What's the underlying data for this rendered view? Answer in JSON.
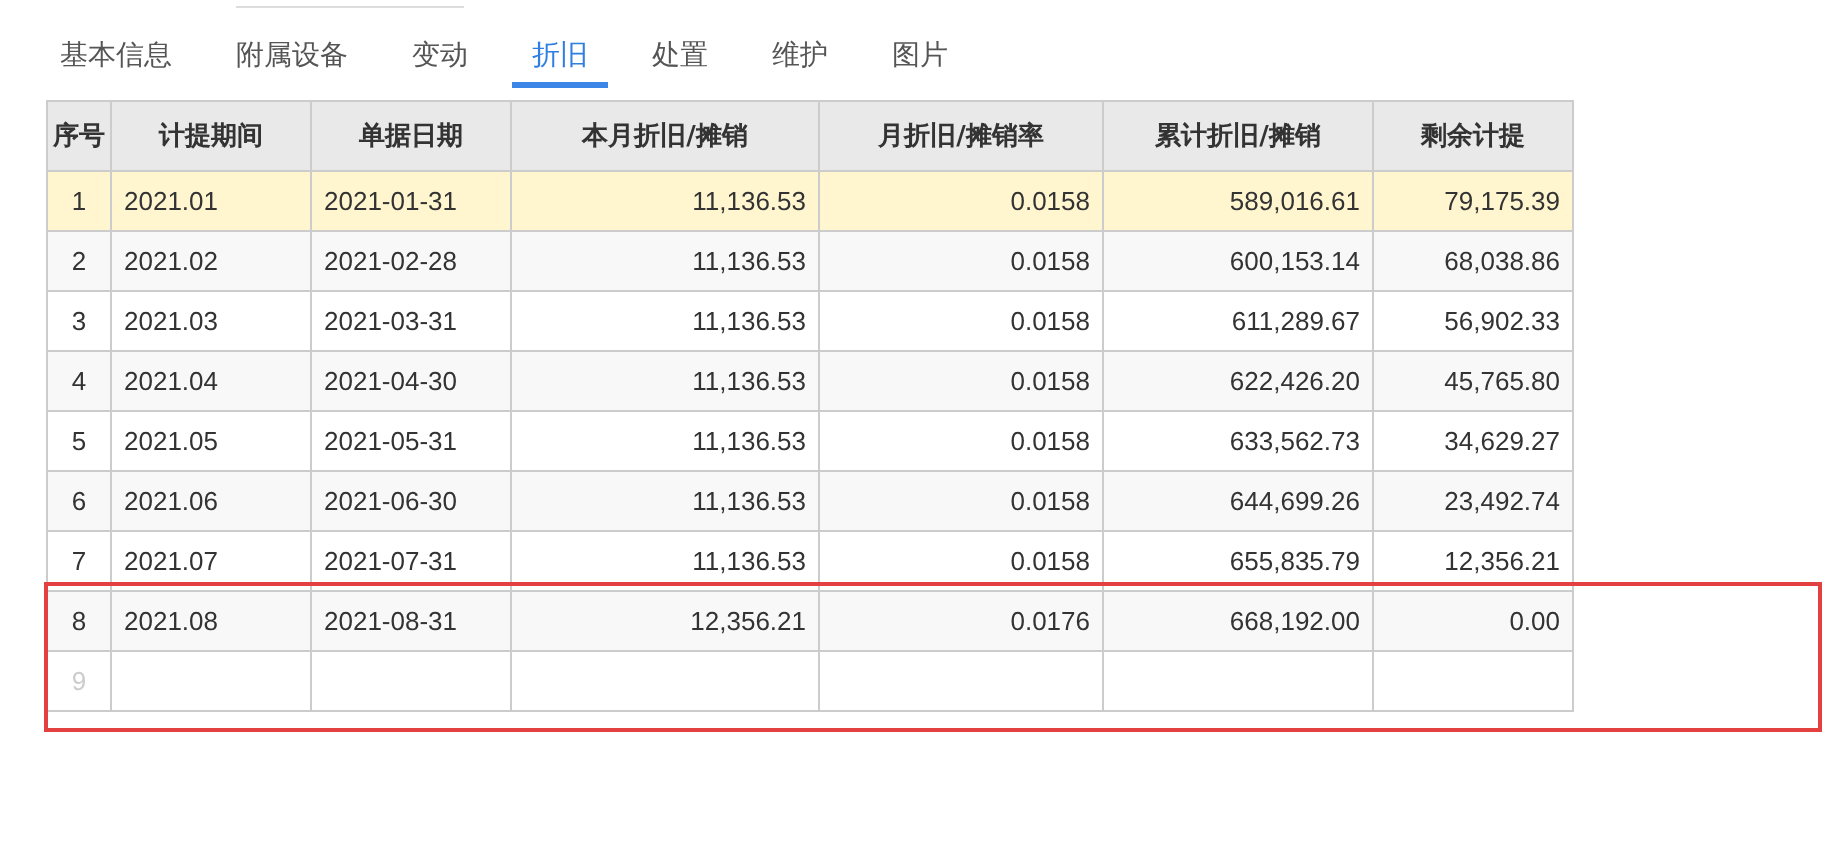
{
  "tabs": [
    {
      "label": "基本信息",
      "selected": false
    },
    {
      "label": "附属设备",
      "selected": false
    },
    {
      "label": "变动",
      "selected": false
    },
    {
      "label": "折旧",
      "selected": true
    },
    {
      "label": "处置",
      "selected": false
    },
    {
      "label": "维护",
      "selected": false
    },
    {
      "label": "图片",
      "selected": false
    }
  ],
  "table": {
    "columns": [
      "序号",
      "计提期间",
      "单据日期",
      "本月折旧/摊销",
      "月折旧/摊销率",
      "累计折旧/摊销",
      "剩余计提"
    ],
    "rows": [
      {
        "cells": [
          "1",
          "2021.01",
          "2021-01-31",
          "11,136.53",
          "0.0158",
          "589,016.61",
          "79,175.39"
        ],
        "selected": true,
        "boxed": false
      },
      {
        "cells": [
          "2",
          "2021.02",
          "2021-02-28",
          "11,136.53",
          "0.0158",
          "600,153.14",
          "68,038.86"
        ],
        "selected": false,
        "boxed": false
      },
      {
        "cells": [
          "3",
          "2021.03",
          "2021-03-31",
          "11,136.53",
          "0.0158",
          "611,289.67",
          "56,902.33"
        ],
        "selected": false,
        "boxed": false
      },
      {
        "cells": [
          "4",
          "2021.04",
          "2021-04-30",
          "11,136.53",
          "0.0158",
          "622,426.20",
          "45,765.80"
        ],
        "selected": false,
        "boxed": false
      },
      {
        "cells": [
          "5",
          "2021.05",
          "2021-05-31",
          "11,136.53",
          "0.0158",
          "633,562.73",
          "34,629.27"
        ],
        "selected": false,
        "boxed": false
      },
      {
        "cells": [
          "6",
          "2021.06",
          "2021-06-30",
          "11,136.53",
          "0.0158",
          "644,699.26",
          "23,492.74"
        ],
        "selected": false,
        "boxed": false
      },
      {
        "cells": [
          "7",
          "2021.07",
          "2021-07-31",
          "11,136.53",
          "0.0158",
          "655,835.79",
          "12,356.21"
        ],
        "selected": false,
        "boxed": false
      },
      {
        "cells": [
          "8",
          "2021.08",
          "2021-08-31",
          "12,356.21",
          "0.0176",
          "668,192.00",
          "0.00"
        ],
        "selected": false,
        "boxed": true
      },
      {
        "cells": [
          "9"
        ],
        "kind": "blank",
        "selected": false,
        "boxed": true
      }
    ]
  }
}
